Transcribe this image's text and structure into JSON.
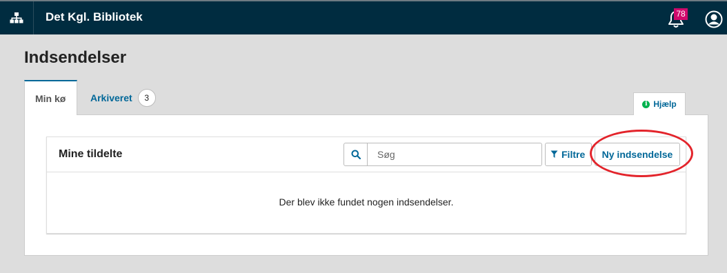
{
  "header": {
    "site_title": "Det Kgl. Bibliotek",
    "notifications_count": "78",
    "icons": [
      "sitemap-icon",
      "bell-icon",
      "user-circle-icon"
    ]
  },
  "page": {
    "title": "Indsendelser"
  },
  "tabs": [
    {
      "label": "Min kø",
      "active": true
    },
    {
      "label": "Arkiveret",
      "count": "3",
      "active": false
    }
  ],
  "help": {
    "label": "Hjælp"
  },
  "list": {
    "title": "Mine tildelte",
    "search_placeholder": "Søg",
    "filter_label": "Filtre",
    "new_label": "Ny indsendelse",
    "empty_message": "Der blev ikke fundet nogen indsendelser."
  },
  "colors": {
    "header_bg": "#002c40",
    "link": "#006798",
    "badge": "#d00a6c",
    "annotation": "#e3242b"
  }
}
